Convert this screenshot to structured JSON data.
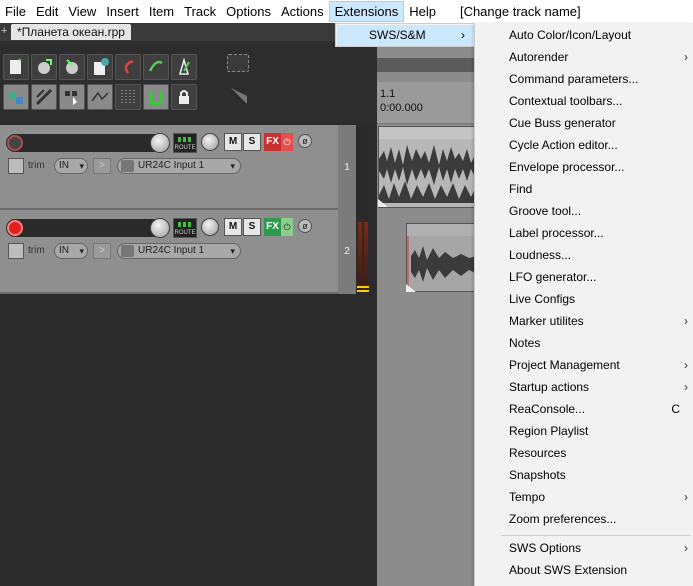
{
  "menubar": {
    "items": [
      "File",
      "Edit",
      "View",
      "Insert",
      "Item",
      "Track",
      "Options",
      "Actions",
      "Extensions",
      "Help"
    ],
    "extra": "[Change track name]"
  },
  "project_tab": {
    "plus": "+",
    "name": "*Планета океан.rpp"
  },
  "ruler": {
    "bar": "1.1",
    "time": "0:00.000"
  },
  "tracks": [
    {
      "number": "1",
      "trim": "trim",
      "in": "IN",
      "input": "UR24C Input 1",
      "route": "ROUTE",
      "m": "M",
      "s": "S",
      "fx": "FX",
      "fx_state": "red"
    },
    {
      "number": "2",
      "trim": "trim",
      "in": "IN",
      "input": "UR24C Input 1",
      "route": "ROUTE",
      "m": "M",
      "s": "S",
      "fx": "FX",
      "fx_state": "green"
    }
  ],
  "extensions_menu": {
    "item": "SWS/S&M"
  },
  "sws_menu": {
    "items": [
      {
        "label": "Auto Color/Icon/Layout"
      },
      {
        "label": "Autorender",
        "submenu": true
      },
      {
        "label": "Command parameters..."
      },
      {
        "label": "Contextual toolbars..."
      },
      {
        "label": "Cue Buss generator"
      },
      {
        "label": "Cycle Action editor..."
      },
      {
        "label": "Envelope processor..."
      },
      {
        "label": "Find"
      },
      {
        "label": "Groove tool..."
      },
      {
        "label": "Label processor..."
      },
      {
        "label": "Loudness..."
      },
      {
        "label": "LFO generator..."
      },
      {
        "label": "Live Configs"
      },
      {
        "label": "Marker utilites",
        "submenu": true
      },
      {
        "label": "Notes"
      },
      {
        "label": "Project Management",
        "submenu": true
      },
      {
        "label": "Startup actions",
        "submenu": true
      },
      {
        "label": "ReaConsole...",
        "shortcut": "C"
      },
      {
        "label": "Region Playlist"
      },
      {
        "label": "Resources"
      },
      {
        "label": "Snapshots"
      },
      {
        "label": "Tempo",
        "submenu": true
      },
      {
        "label": "Zoom preferences..."
      }
    ],
    "footer": [
      {
        "label": "SWS Options",
        "submenu": true
      },
      {
        "label": "About SWS Extension"
      }
    ]
  },
  "colors": {
    "accent_highlight": "#cce8ff",
    "fx_red": "#c93030",
    "fx_green": "#2c9c4c",
    "rec_armed": "#e02020"
  }
}
